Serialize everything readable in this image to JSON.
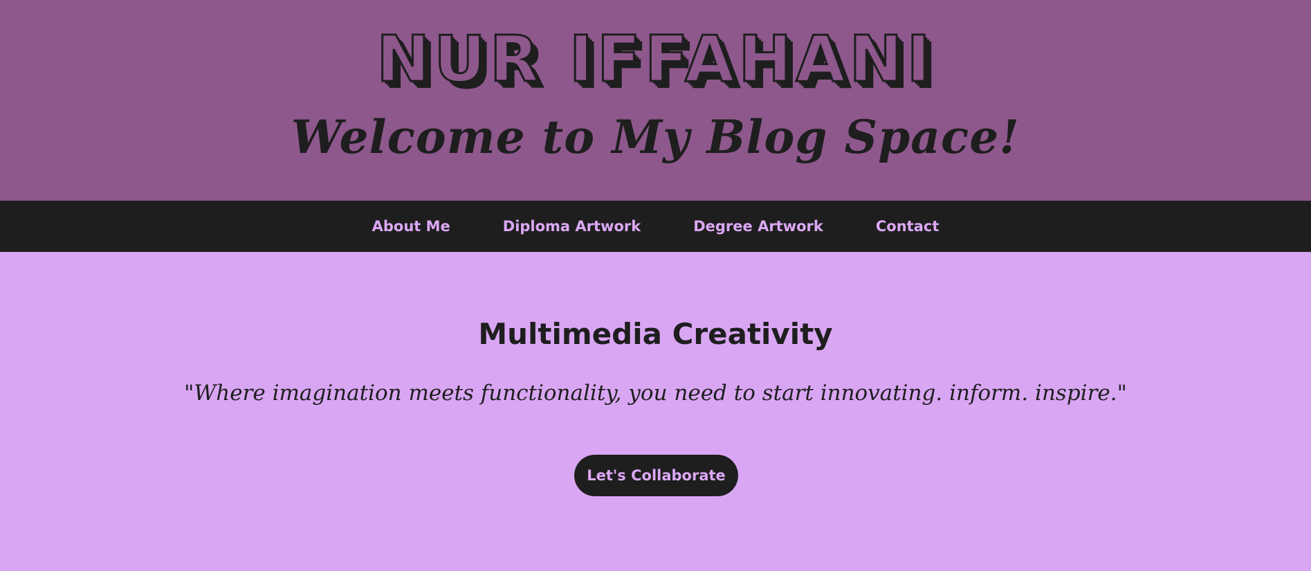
{
  "header": {
    "title": "NUR IFFAHANI",
    "subtitle": "Welcome to My Blog Space!"
  },
  "nav": {
    "items": [
      {
        "label": "About Me"
      },
      {
        "label": "Diploma Artwork"
      },
      {
        "label": "Degree Artwork"
      },
      {
        "label": "Contact"
      }
    ]
  },
  "hero": {
    "heading": "Multimedia Creativity",
    "quote": "\"Where imagination meets functionality, you need to start innovating. inform. inspire.\"",
    "cta_label": "Let's Collaborate"
  },
  "colors": {
    "header_bg": "#8e588d",
    "nav_bg": "#1e1e1e",
    "hero_bg": "#d9a6f3",
    "accent_text": "#dca8f5",
    "dark_text": "#1e1e1e"
  }
}
